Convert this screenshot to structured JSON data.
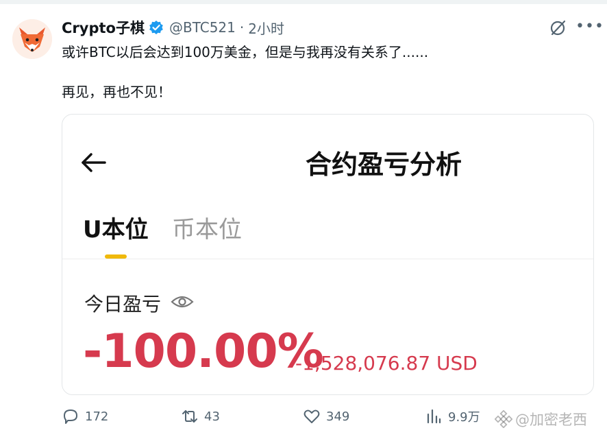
{
  "tweet": {
    "author_name": "Crypto子棋",
    "handle": "@BTC521",
    "separator": "·",
    "time": "2小时",
    "text_line1": "或许BTC以后会达到100万美金，但是与我再没有关系了......",
    "text_line2": "再见，再也不见！"
  },
  "card": {
    "title": "合约盈亏分析",
    "tabs": [
      {
        "label": "U本位",
        "active": true
      },
      {
        "label": "币本位",
        "active": false
      }
    ],
    "pnl_label": "今日盈亏",
    "pnl_percent": "-100.00%",
    "pnl_amount": "-1,528,076.87 USD"
  },
  "actions": {
    "replies": "172",
    "retweets": "43",
    "likes": "349",
    "views": "9.9万"
  },
  "watermark": {
    "text": "@加密老西"
  },
  "colors": {
    "loss_red": "#d63a4e",
    "tab_accent": "#f0b90b",
    "verified_blue": "#1d9bf0",
    "secondary_text": "#536471"
  },
  "icons": {
    "avatar": "fox-logo-icon",
    "verified": "verified-badge-icon",
    "grok": "grok-icon",
    "more": "more-icon",
    "back": "back-arrow-icon",
    "eye": "eye-icon",
    "reply": "reply-icon",
    "retweet": "retweet-icon",
    "like": "heart-icon",
    "views": "views-icon"
  }
}
